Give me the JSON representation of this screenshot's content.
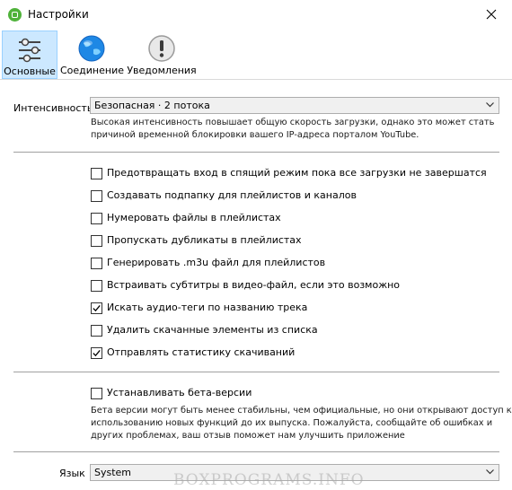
{
  "window": {
    "title": "Настройки"
  },
  "toolbar": {
    "tabs": [
      {
        "label": "Основные",
        "icon": "sliders-icon"
      },
      {
        "label": "Соединение",
        "icon": "globe-icon"
      },
      {
        "label": "Уведомления",
        "icon": "exclamation-icon"
      }
    ],
    "active_tab": "Основные"
  },
  "intensity": {
    "label": "Интенсивность",
    "value": "Безопасная · 2 потока",
    "hint_line1": "Высокая интенсивность повышает общую скорость загрузки, однако это может стать",
    "hint_line2": "причиной временной блокировки вашего IP-адреса порталом YouTube."
  },
  "options": [
    {
      "label": "Предотвращать вход в спящий режим пока все загрузки не завершатся",
      "checked": false
    },
    {
      "label": "Создавать подпапку для плейлистов и каналов",
      "checked": false
    },
    {
      "label": "Нумеровать файлы в плейлистах",
      "checked": false
    },
    {
      "label": "Пропускать дубликаты в плейлистах",
      "checked": false
    },
    {
      "label": "Генерировать .m3u файл для плейлистов",
      "checked": false
    },
    {
      "label": "Встраивать субтитры в видео-файл, если это возможно",
      "checked": false
    },
    {
      "label": "Искать аудио-теги по названию трека",
      "checked": true
    },
    {
      "label": "Удалить скачанные элементы из списка",
      "checked": false
    },
    {
      "label": "Отправлять статистику скачиваний",
      "checked": true
    }
  ],
  "beta": {
    "label": "Устанавливать бета-версии",
    "checked": false,
    "hint_line1": "Бета версии могут быть менее стабильны, чем официальные, но они открывают доступ к",
    "hint_line2": "использованию новых функций до их выпуска. Пожалуйста, сообщайте об ошибках и",
    "hint_line3": "других проблемах, ваш отзыв поможет нам улучшить приложение"
  },
  "language": {
    "label": "Язык",
    "value": "System"
  },
  "watermark": "BOXPROGRAMS.INFO",
  "colors": {
    "active_tab_bg": "#cce8ff",
    "app_icon": "#4fb23a",
    "globe": "#1e88e5"
  }
}
